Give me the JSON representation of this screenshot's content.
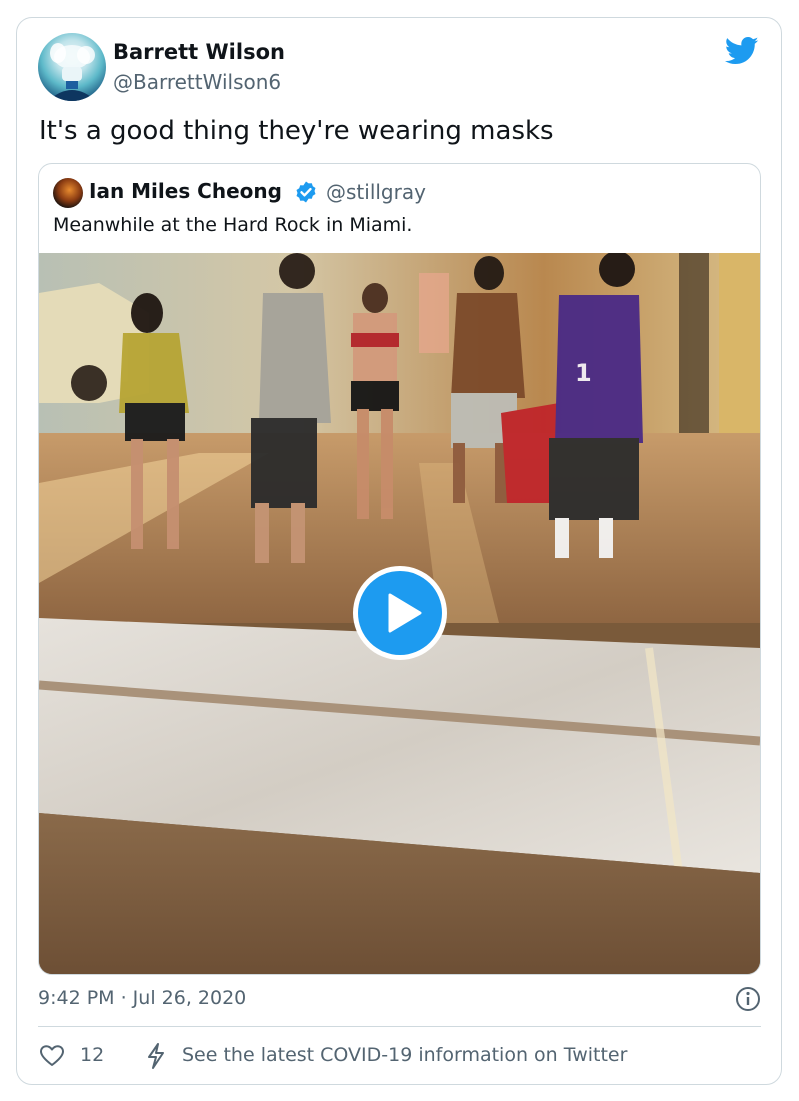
{
  "tweet": {
    "author_name": "Barrett Wilson",
    "author_handle": "@BarrettWilson6",
    "text": "It's a good thing they're wearing masks",
    "timestamp": "9:42 PM · Jul 26, 2020",
    "like_count": "12",
    "covid_link": "See the latest COVID-19 information on Twitter"
  },
  "quoted_tweet": {
    "author_name": "Ian Miles Cheong",
    "author_handle": "@stillgray",
    "verified": true,
    "text": "Meanwhile at the Hard Rock in Miami.",
    "media": {
      "type": "video",
      "jersey_number": "1"
    }
  },
  "icons": {
    "brand": "twitter-bird-icon",
    "verified": "verified-badge-icon",
    "play": "play-icon",
    "info": "info-icon",
    "like": "heart-icon",
    "covid": "lightning-icon"
  },
  "colors": {
    "accent": "#1d9bf0",
    "text": "#0f1419",
    "secondary_text": "#536471",
    "border": "#cfd9de"
  }
}
